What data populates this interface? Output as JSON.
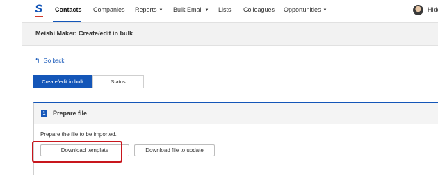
{
  "nav": {
    "items": [
      {
        "label": "Contacts",
        "active": true
      },
      {
        "label": "Companies",
        "active": false
      },
      {
        "label": "Reports",
        "dropdown": true
      },
      {
        "label": "Bulk Email",
        "dropdown": true
      },
      {
        "label": "Lists",
        "active": false
      },
      {
        "label": "Colleagues",
        "active": false
      },
      {
        "label": "Opportunities",
        "dropdown": true
      }
    ],
    "user_name": "Hide"
  },
  "page": {
    "title": "Meishi Maker: Create/edit in bulk",
    "go_back": "Go back"
  },
  "tabs": [
    {
      "label": "Create/edit in bulk",
      "active": true
    },
    {
      "label": "Status",
      "active": false
    }
  ],
  "step": {
    "number": "1",
    "title": "Prepare file",
    "description": "Prepare the file to be imported.",
    "buttons": {
      "download_template": "Download template",
      "download_update": "Download file to update"
    }
  },
  "colors": {
    "accent": "#1456b8",
    "highlight": "#c8161d",
    "logo_bar": "#d23a2a"
  },
  "icons": [
    "logo-icon",
    "go-back-arrow-icon",
    "chevron-down-icon",
    "avatar"
  ]
}
